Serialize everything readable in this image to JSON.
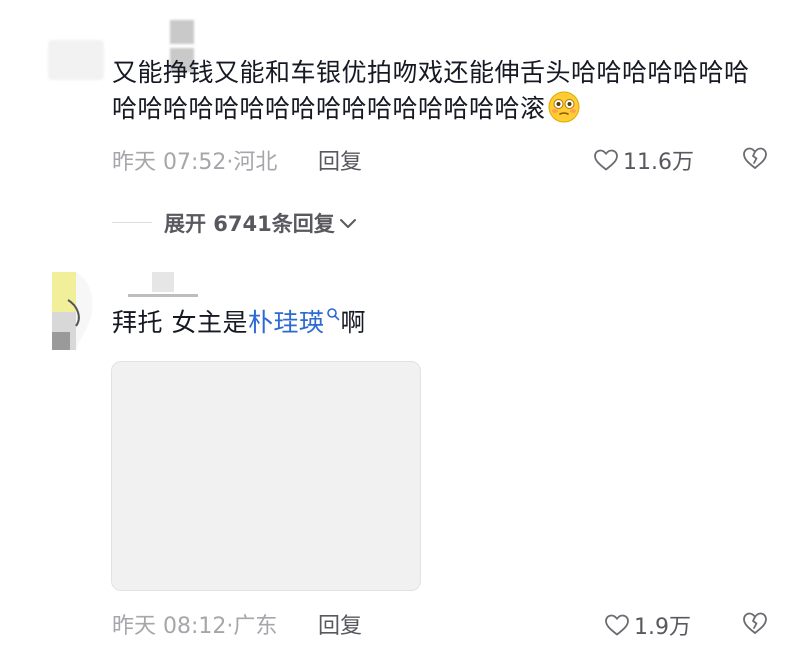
{
  "comments": [
    {
      "text": "又能挣钱又能和车银优拍吻戏还能伸舌头哈哈哈哈哈哈哈哈哈哈哈哈哈哈哈哈哈哈哈哈哈哈哈滚",
      "emoji": "flushed-face-emoji",
      "time": "昨天 07:52",
      "location": "·河北",
      "reply_label": "回复",
      "likes": "11.6万",
      "expand_label": "展开 6741条回复"
    },
    {
      "text_before": "拜托 女主是",
      "keyword": "朴珪瑛",
      "text_after": "啊",
      "time": "昨天 08:12",
      "location": "·广东",
      "reply_label": "回复",
      "likes": "1.9万"
    }
  ],
  "colors": {
    "primary_text": "#161823",
    "meta_text": "#a6a6ab",
    "action_text": "#58595f",
    "keyword": "#2c6ad1",
    "image_placeholder": "#f1f1f1"
  }
}
